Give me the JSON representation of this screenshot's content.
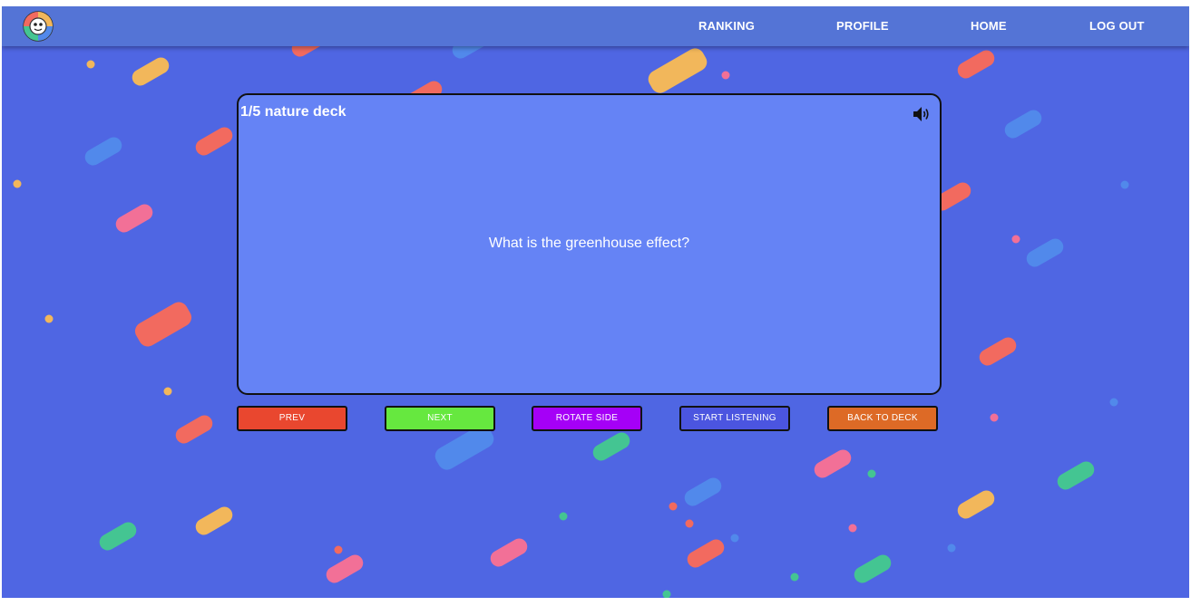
{
  "nav": {
    "links": [
      "RANKING",
      "PROFILE",
      "HOME",
      "LOG OUT"
    ],
    "logo_icon": "quiz-mascot-logo-icon"
  },
  "card": {
    "deck_title": "1/5 nature deck",
    "question": "What is the greenhouse effect?",
    "speaker_icon": "speaker-icon"
  },
  "buttons": {
    "prev": "PREV",
    "next": "NEXT",
    "rotate": "ROTATE SIDE",
    "listen": "START LISTENING",
    "back": "BACK TO DECK"
  },
  "colors": {
    "background": "#4f66e3",
    "navbar": "#5474d6",
    "card": "#6583f5",
    "prev": "#e9472f",
    "next": "#66e83f",
    "rotate": "#a500f7",
    "listen": "#4b55e0",
    "back": "#dd6a26"
  }
}
